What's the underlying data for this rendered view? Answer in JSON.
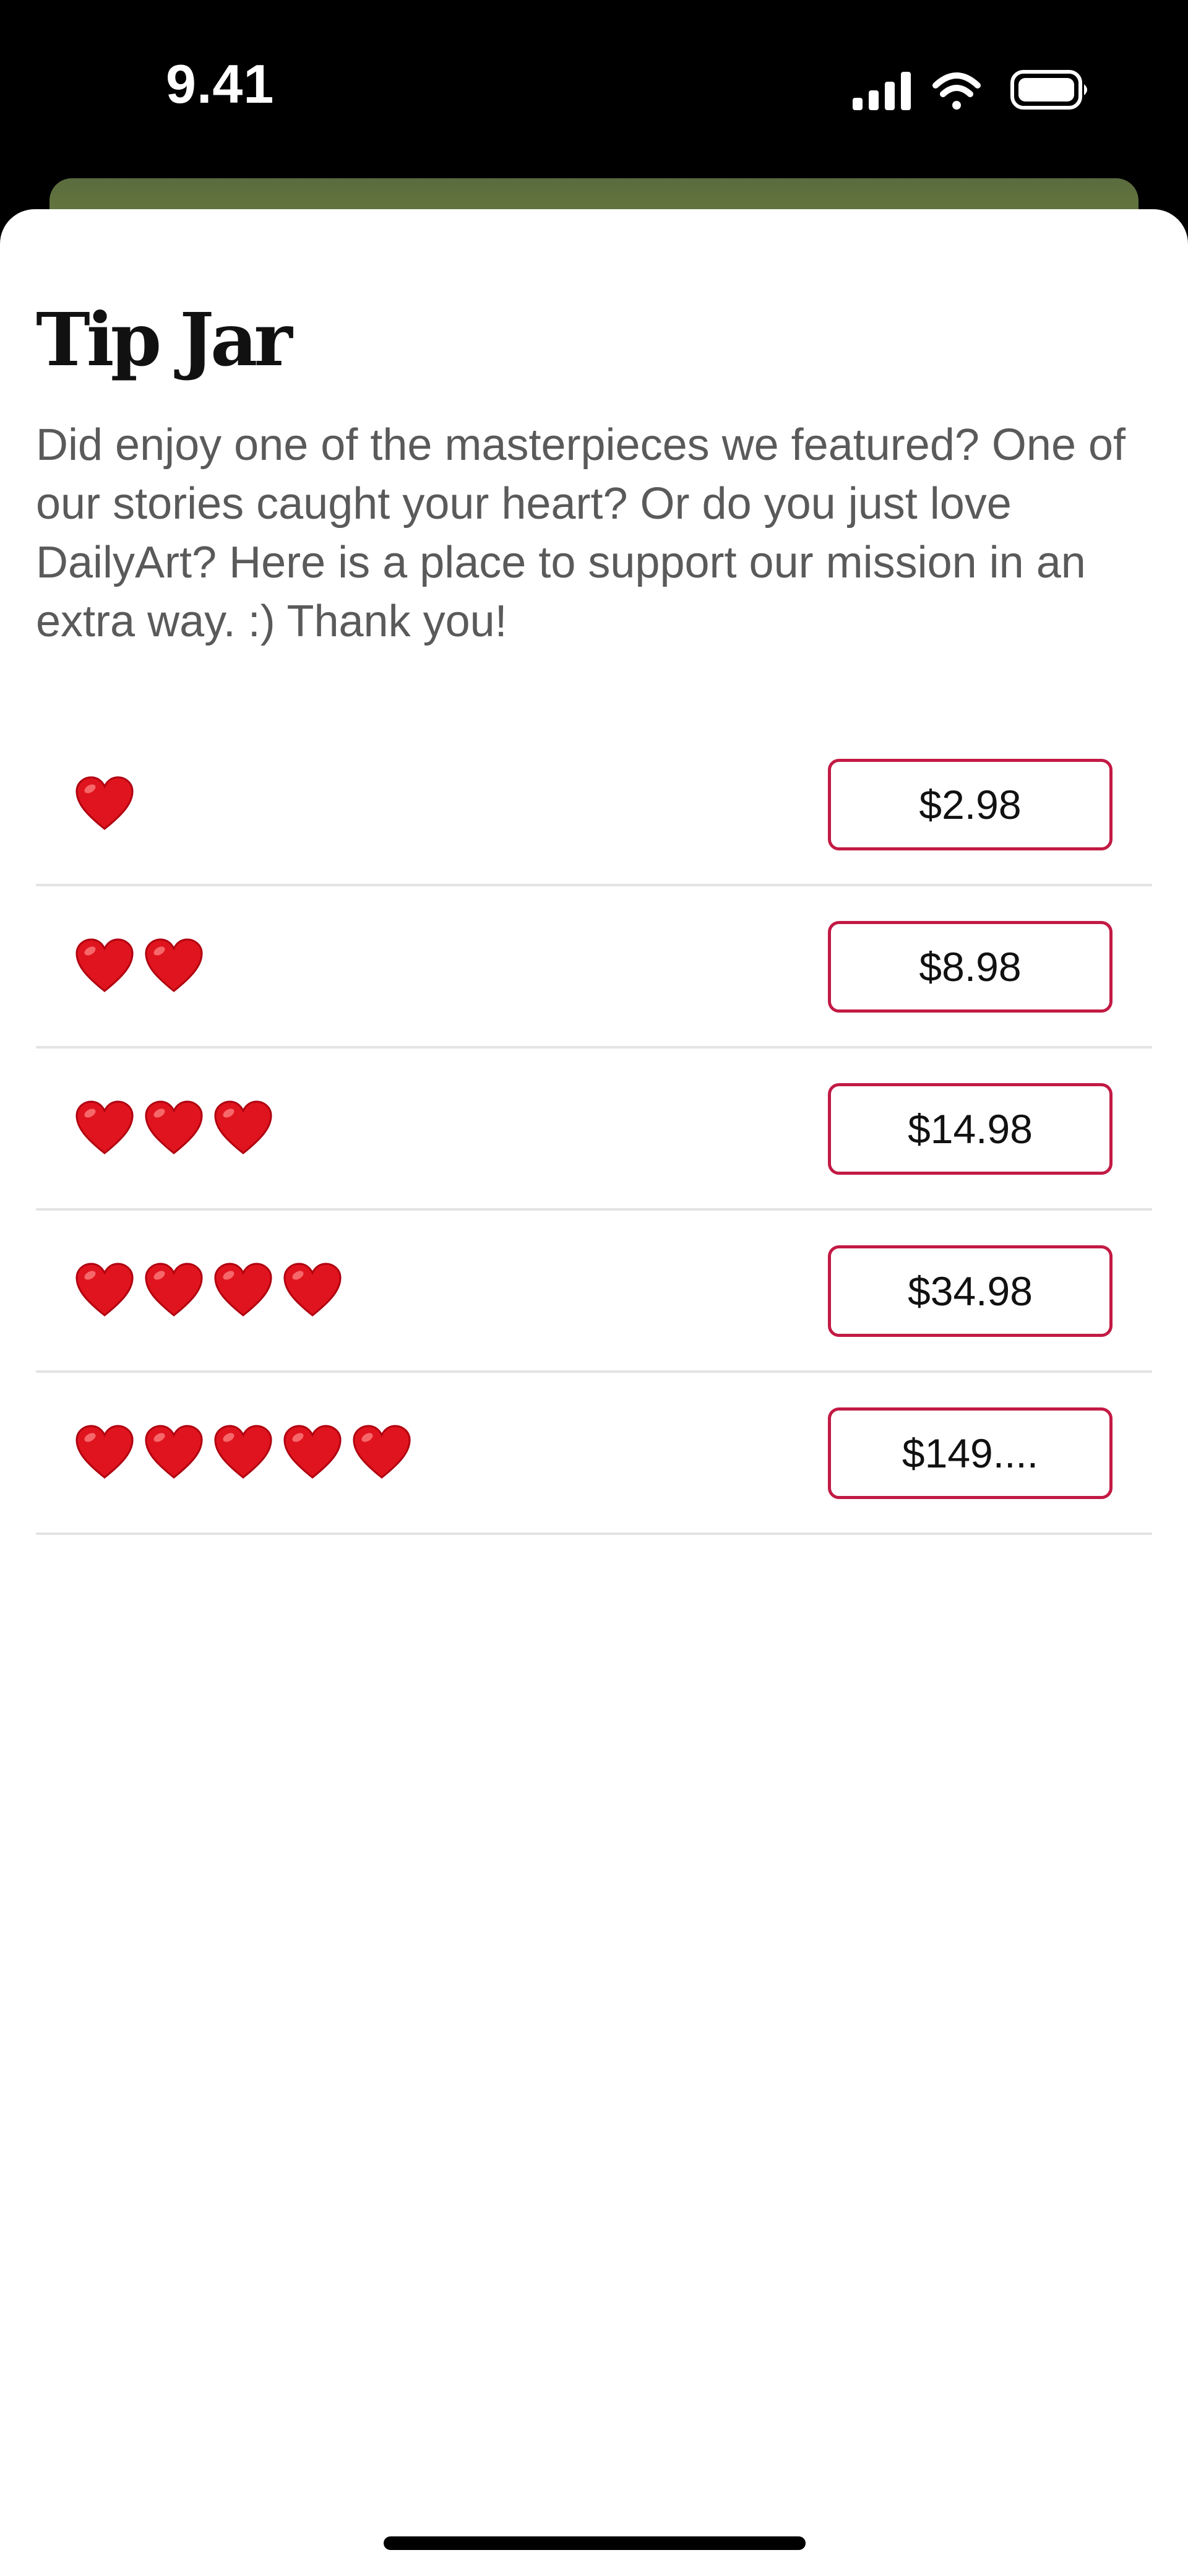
{
  "status_bar": {
    "time": "9.41",
    "icons": [
      "cellular-signal-icon",
      "wifi-icon",
      "battery-icon"
    ]
  },
  "colors": {
    "accent": "#c21a44",
    "heart": "#e0141e",
    "text_primary": "#111111",
    "text_secondary": "#5a5a5a",
    "divider": "#e4e4e4"
  },
  "tip_jar": {
    "title": "Tip Jar",
    "description": "Did enjoy one of the masterpieces we featured? One of our stories caught your heart? Or do you just love DailyArt? Here is a place to support our mission in an extra way. :) Thank you!",
    "tiers": [
      {
        "hearts": 1,
        "price_label": "$2.98"
      },
      {
        "hearts": 2,
        "price_label": "$8.98"
      },
      {
        "hearts": 3,
        "price_label": "$14.98"
      },
      {
        "hearts": 4,
        "price_label": "$34.98"
      },
      {
        "hearts": 5,
        "price_label": "$149...."
      }
    ]
  }
}
